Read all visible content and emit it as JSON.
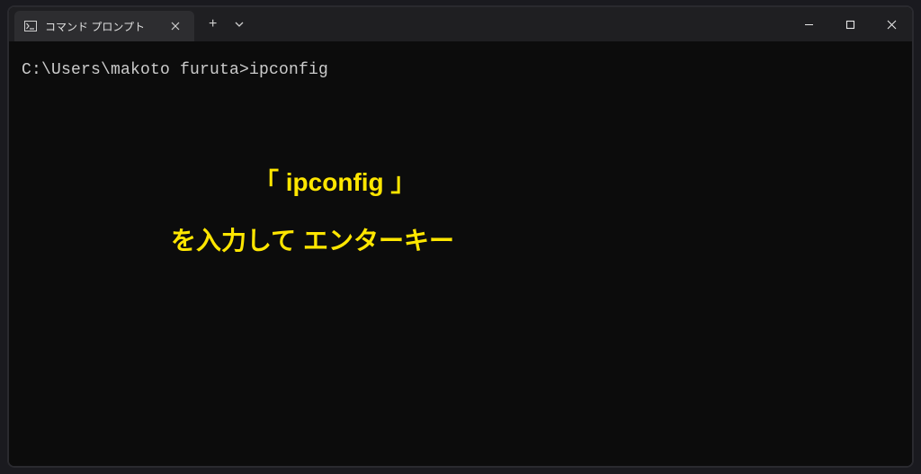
{
  "window": {
    "tab": {
      "title": "コマンド プロンプト"
    }
  },
  "terminal": {
    "prompt": "C:\\Users\\makoto furuta>",
    "command": "ipconfig"
  },
  "annotation": {
    "line1": "「 ipconfig 」",
    "line2": "を入力して エンターキー"
  }
}
